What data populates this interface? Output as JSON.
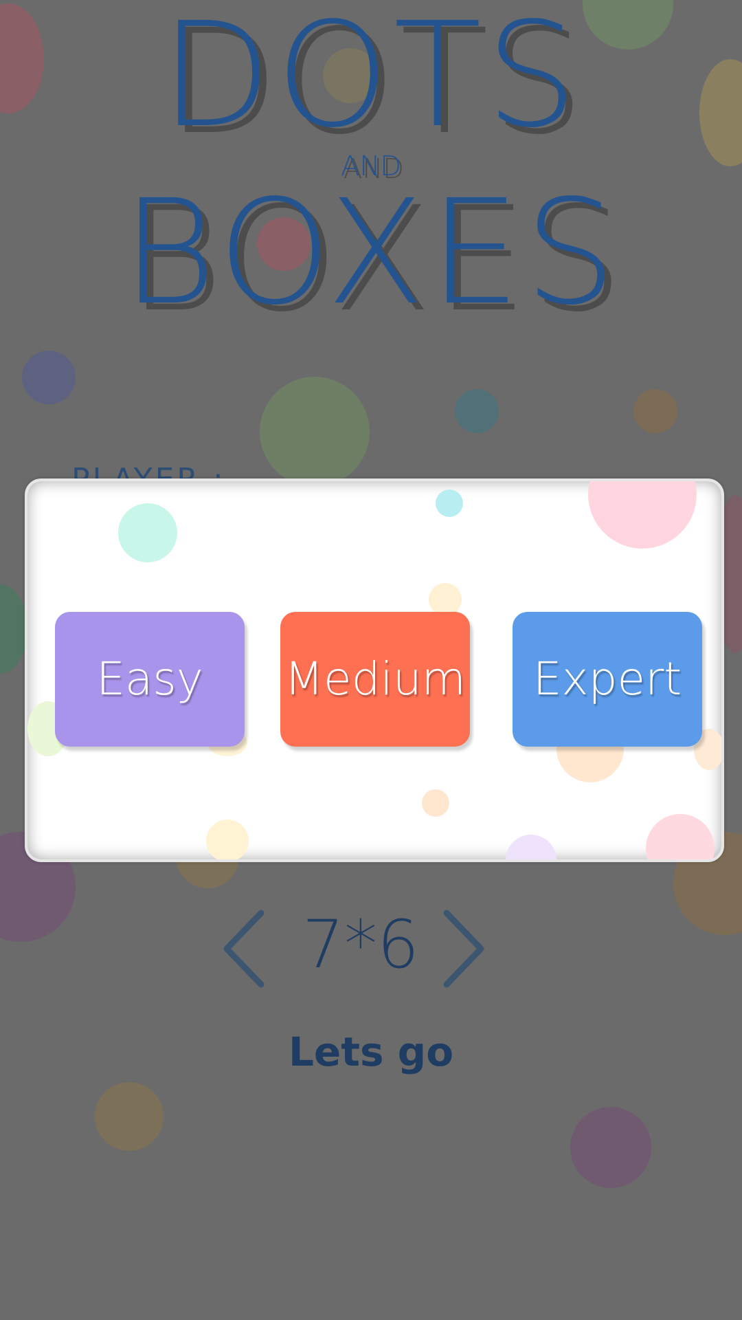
{
  "title": {
    "line1": "DOTS",
    "line2": "AND",
    "line3": "BOXES"
  },
  "player_label": "PLAYER :",
  "level_dialog": {
    "buttons": [
      {
        "label": "Easy",
        "color": "#a994eb"
      },
      {
        "label": "Medium",
        "color": "#fd7052"
      },
      {
        "label": "Expert",
        "color": "#5b9be9"
      }
    ]
  },
  "board_size": {
    "value": "7*6"
  },
  "start_label": "Lets go",
  "colors": {
    "background_dim": "#6b6b6b",
    "title": "#24548f",
    "text_dark": "#1f3c62",
    "dialog_bg": "#ffffff"
  },
  "icons": {
    "prev": "chevron-left-icon",
    "next": "chevron-right-icon"
  }
}
